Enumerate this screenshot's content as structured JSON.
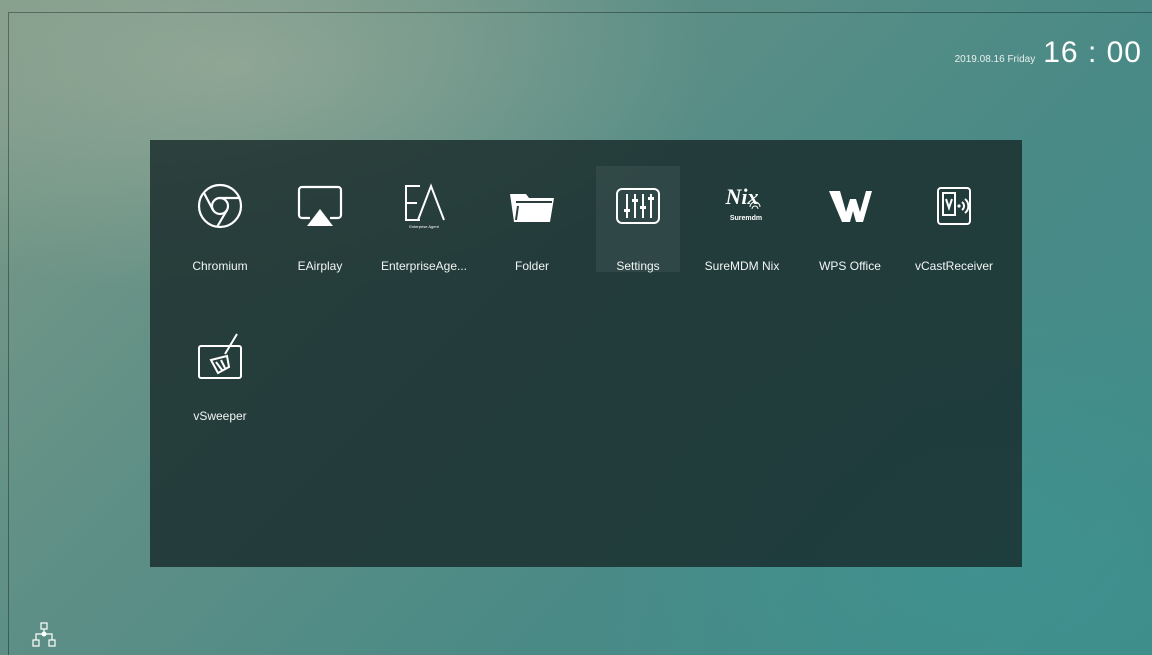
{
  "status": {
    "date": "2019.08.16 Friday",
    "time": "16 : 00"
  },
  "apps": [
    {
      "label": "Chromium",
      "icon": "chromium-icon"
    },
    {
      "label": "EAirplay",
      "icon": "airplay-icon"
    },
    {
      "label": "EnterpriseAge...",
      "icon": "enterprise-agent-icon",
      "icon_text": "Enterprise Agent"
    },
    {
      "label": "Folder",
      "icon": "folder-icon"
    },
    {
      "label": "Settings",
      "icon": "settings-sliders-icon"
    },
    {
      "label": "SureMDM Nix",
      "icon": "suremdm-nix-icon",
      "icon_text": "Nix",
      "icon_subtext": "Suremdm"
    },
    {
      "label": "WPS Office",
      "icon": "wps-office-icon"
    },
    {
      "label": "vCastReceiver",
      "icon": "vcast-receiver-icon"
    },
    {
      "label": "vSweeper",
      "icon": "broom-icon"
    }
  ],
  "focused_app": "Settings",
  "bottom_icon": "network-icon",
  "colors": {
    "panel": "#16282880",
    "background_accent": "#3f8c89",
    "text": "#ffffff"
  }
}
